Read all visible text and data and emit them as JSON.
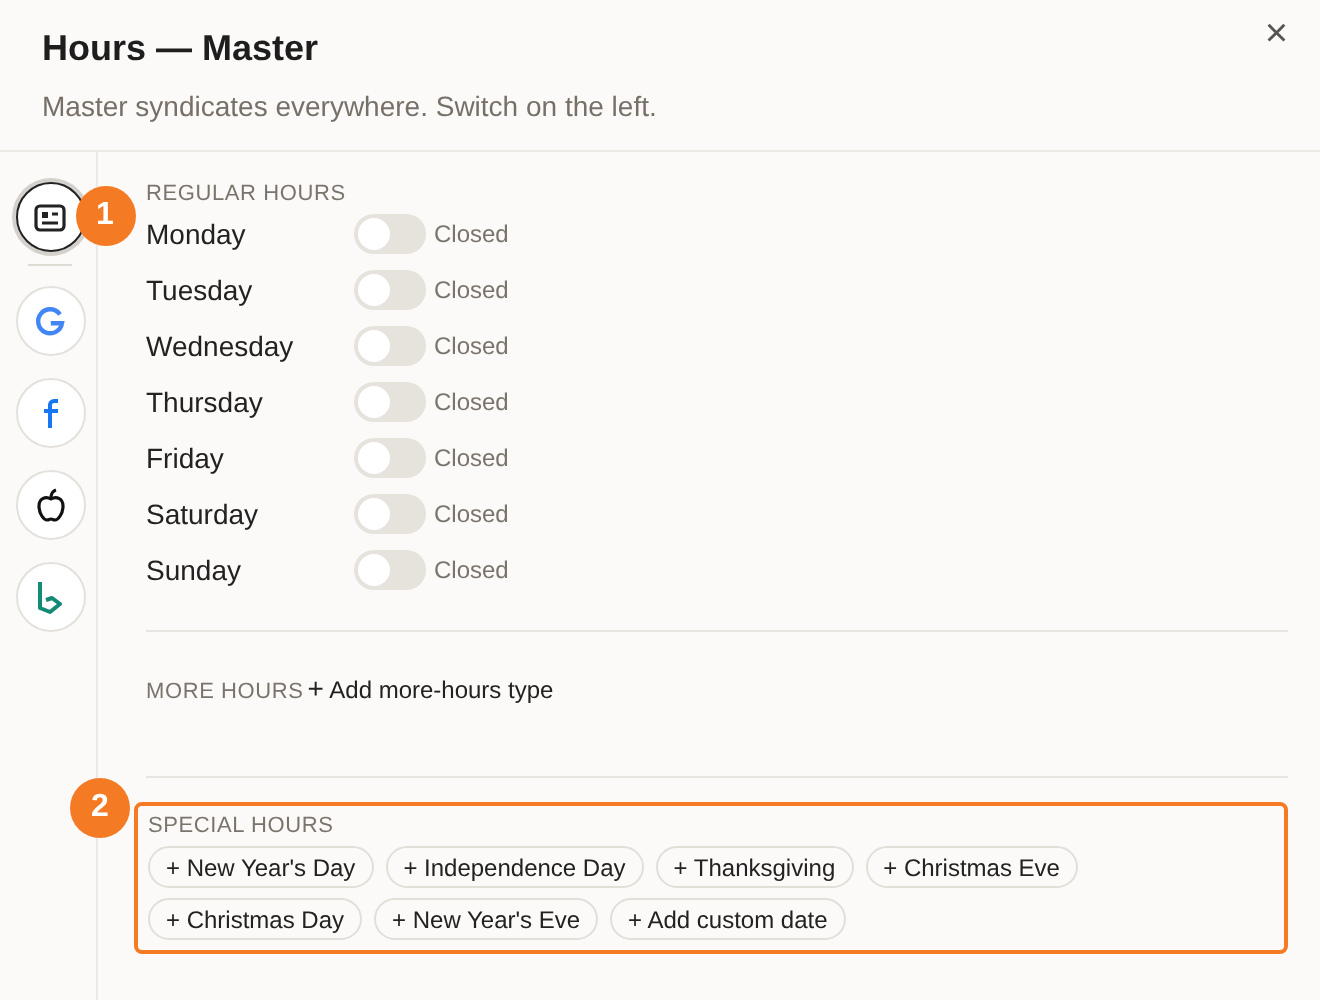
{
  "dialog": {
    "title": "Hours — Master",
    "subtitle": "Master syndicates everywhere. Switch on the left.",
    "close": "×"
  },
  "sidebar": {
    "items": [
      {
        "kind": "master",
        "selected": true,
        "callout": "1"
      },
      {
        "kind": "google",
        "selected": false
      },
      {
        "kind": "facebook",
        "selected": false
      },
      {
        "kind": "apple",
        "selected": false
      },
      {
        "kind": "bing",
        "selected": false
      }
    ]
  },
  "regular_hours": {
    "heading": "REGULAR HOURS",
    "days": [
      {
        "day": "Monday",
        "on": false,
        "status": "Closed"
      },
      {
        "day": "Tuesday",
        "on": false,
        "status": "Closed"
      },
      {
        "day": "Wednesday",
        "on": false,
        "status": "Closed"
      },
      {
        "day": "Thursday",
        "on": false,
        "status": "Closed"
      },
      {
        "day": "Friday",
        "on": false,
        "status": "Closed"
      },
      {
        "day": "Saturday",
        "on": false,
        "status": "Closed"
      },
      {
        "day": "Sunday",
        "on": false,
        "status": "Closed"
      }
    ]
  },
  "more_hours": {
    "heading": "MORE HOURS",
    "plus": "+",
    "action": "Add more-hours type"
  },
  "special_hours": {
    "heading": "SPECIAL HOURS",
    "callout": "2",
    "chips": [
      "+ New Year's Day",
      "+ Independence Day",
      "+ Thanksgiving",
      "+ Christmas Eve",
      "+ Christmas Day",
      "+ New Year's Eve",
      "+ Add custom date"
    ]
  }
}
